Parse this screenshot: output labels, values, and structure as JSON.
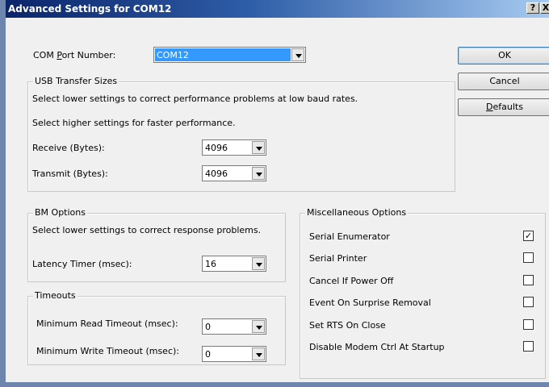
{
  "window": {
    "title": "Advanced Settings for COM12",
    "help_glyph": "?",
    "close_glyph": "X"
  },
  "com_port": {
    "label_prefix": "COM ",
    "label_accel": "P",
    "label_suffix": "ort Number:",
    "value": "COM12"
  },
  "buttons": {
    "ok": "OK",
    "cancel": "Cancel",
    "defaults_accel": "D",
    "defaults_rest": "efaults"
  },
  "usb": {
    "legend": "USB Transfer Sizes",
    "hint_low": "Select lower settings to correct performance problems at low baud rates.",
    "hint_high": "Select higher settings for faster performance.",
    "receive_label": "Receive (Bytes):",
    "receive_value": "4096",
    "transmit_label": "Transmit (Bytes):",
    "transmit_value": "4096"
  },
  "bm": {
    "legend": "BM Options",
    "hint": "Select lower settings to correct response problems.",
    "latency_label": "Latency Timer (msec):",
    "latency_value": "16"
  },
  "timeouts": {
    "legend": "Timeouts",
    "read_label": "Minimum Read Timeout (msec):",
    "read_value": "0",
    "write_label": "Minimum Write Timeout (msec):",
    "write_value": "0"
  },
  "misc": {
    "legend": "Miscellaneous Options",
    "checked_glyph": "✓",
    "options": [
      {
        "label": "Serial Enumerator",
        "checked": true
      },
      {
        "label": "Serial Printer",
        "checked": false
      },
      {
        "label": "Cancel If Power Off",
        "checked": false
      },
      {
        "label": "Event On Surprise Removal",
        "checked": false
      },
      {
        "label": "Set RTS On Close",
        "checked": false
      },
      {
        "label": "Disable Modem Ctrl At Startup",
        "checked": false
      }
    ]
  }
}
